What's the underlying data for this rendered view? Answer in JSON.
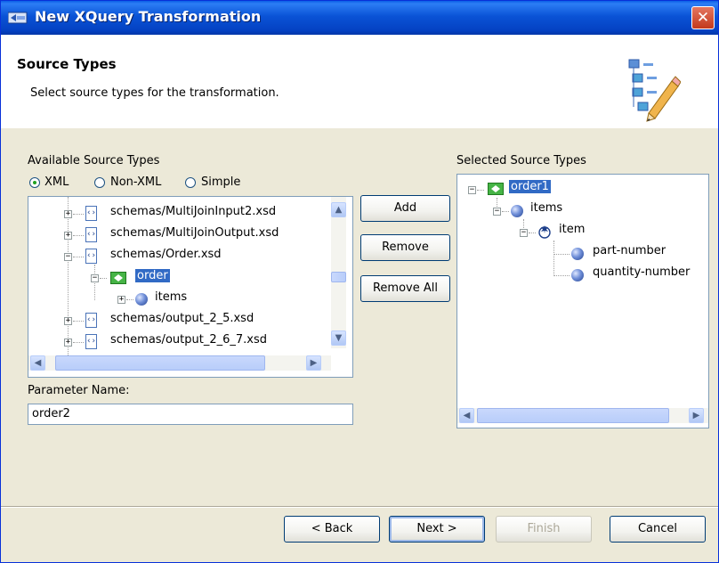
{
  "window": {
    "title": "New XQuery Transformation",
    "icon": "dialog-icon",
    "close_symbol": "✕"
  },
  "banner": {
    "title": "Source Types",
    "description": "Select source types for the transformation.",
    "icon": "schema-pencil-icon"
  },
  "available": {
    "label": "Available Source Types",
    "radios": [
      {
        "label": "XML",
        "checked": true
      },
      {
        "label": "Non-XML",
        "checked": false
      },
      {
        "label": "Simple",
        "checked": false
      }
    ],
    "tree": [
      {
        "text": "schemas/MultiJoinInput2.xsd",
        "expander": "+"
      },
      {
        "text": "schemas/MultiJoinOutput.xsd",
        "expander": "+"
      },
      {
        "text": "schemas/Order.xsd",
        "expander": "−"
      },
      {
        "text": "order",
        "expander": "−",
        "selected": true
      },
      {
        "text": "items",
        "expander": "+"
      },
      {
        "text": "schemas/output_2_5.xsd",
        "expander": "+"
      },
      {
        "text": "schemas/output_2_6_7.xsd",
        "expander": "+"
      }
    ]
  },
  "buttons": {
    "add": "Add",
    "remove": "Remove",
    "remove_all": "Remove All"
  },
  "parameter": {
    "label": "Parameter Name:",
    "value": "order2"
  },
  "selected": {
    "label": "Selected Source Types",
    "tree": [
      {
        "text": "order1",
        "expander": "−",
        "selected": true
      },
      {
        "text": "items",
        "expander": "−"
      },
      {
        "text": "item",
        "expander": "−"
      },
      {
        "text": "part-number"
      },
      {
        "text": "quantity-number"
      }
    ]
  },
  "footer": {
    "back": "< Back",
    "next": "Next >",
    "finish": "Finish",
    "cancel": "Cancel"
  },
  "colors": {
    "title_bar": "#0a53d6",
    "selection": "#316ac5",
    "dialog_bg": "#ece9d8"
  }
}
